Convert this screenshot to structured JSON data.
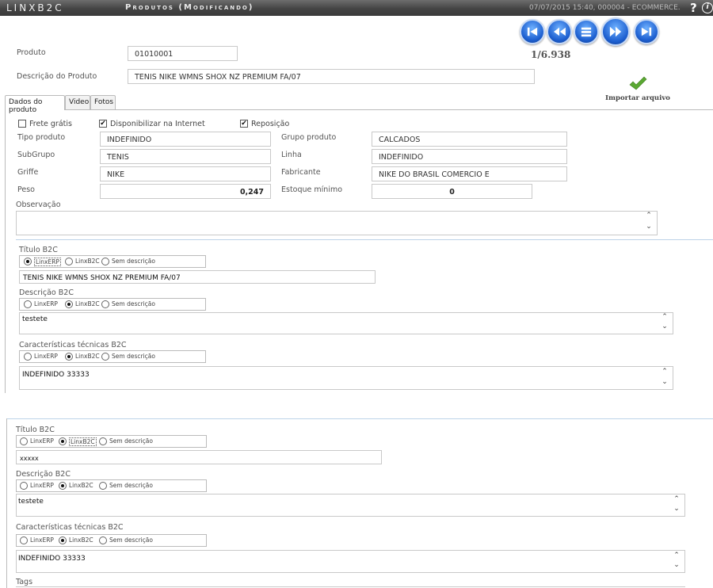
{
  "titlebar": {
    "app_name": "LINXB2C",
    "screen_title": "Produtos (Modificando)",
    "session_info": "07/07/2015 15:40, 000004 - ECOMMERCE.",
    "help_glyph": "?",
    "info_glyph": "i"
  },
  "nav": {
    "counter": "1/6.938",
    "buttons": [
      "first-record",
      "previous-record",
      "list-view",
      "next-record",
      "last-record"
    ]
  },
  "header": {
    "produto_label": "Produto",
    "produto_value": "01010001",
    "descricao_label": "Descrição do Produto",
    "descricao_value": "TENIS NIKE WMNS SHOX NZ PREMIUM FA/07"
  },
  "tabs": [
    {
      "label": "Dados do produto",
      "active": true
    },
    {
      "label": "Video",
      "active": false
    },
    {
      "label": "Fotos",
      "active": false
    }
  ],
  "import": {
    "label": "Importar arquivo",
    "icon": "checkmark-icon",
    "color": "#5aa832"
  },
  "checkboxes": {
    "frete": {
      "label": "Frete grátis",
      "checked": false,
      "mark": ""
    },
    "internet": {
      "label": "Disponibilizar na Internet",
      "checked": true,
      "mark": "✔"
    },
    "reposicao": {
      "label": "Reposição",
      "checked": true,
      "mark": "✔"
    }
  },
  "fields": {
    "tipo_label": "Tipo produto",
    "tipo_value": "INDEFINIDO",
    "grupo_label": "Grupo produto",
    "grupo_value": "CALCADOS",
    "subgrupo_label": "SubGrupo",
    "subgrupo_value": "TENIS",
    "linha_label": "Linha",
    "linha_value": "INDEFINIDO",
    "griffe_label": "Griffe",
    "griffe_value": "NIKE",
    "fabricante_label": "Fabricante",
    "fabricante_value": "NIKE DO BRASIL COMERCIO E",
    "peso_label": "Peso",
    "peso_value": "0,247",
    "estoque_label": "Estoque mínimo",
    "estoque_value": "0",
    "observacao_label": "Observação",
    "observacao_value": ""
  },
  "radio_options": {
    "erp": "LinxERP",
    "b2c": "LinxB2C",
    "none": "Sem descrição"
  },
  "scroll": {
    "up": "⌃",
    "down": "⌄"
  },
  "panel1": {
    "titulo": {
      "label": "Título B2C",
      "selected": "erp",
      "focus": "erp",
      "value": "TENIS NIKE WMNS SHOX NZ PREMIUM FA/07"
    },
    "descricao": {
      "label": "Descrição B2C",
      "selected": "b2c",
      "value": "testete"
    },
    "caracteristicas": {
      "label": "Características técnicas B2C",
      "selected": "b2c",
      "value": "INDEFINIDO 33333"
    }
  },
  "panel2": {
    "titulo": {
      "label": "Título B2C",
      "selected": "b2c",
      "focus": "b2c",
      "value": "xxxxx"
    },
    "descricao": {
      "label": "Descrição B2C",
      "selected": "b2c",
      "value": "testete"
    },
    "caracteristicas": {
      "label": "Características técnicas B2C",
      "selected": "b2c",
      "value": "INDEFINIDO 33333"
    },
    "tags_label": "Tags"
  }
}
